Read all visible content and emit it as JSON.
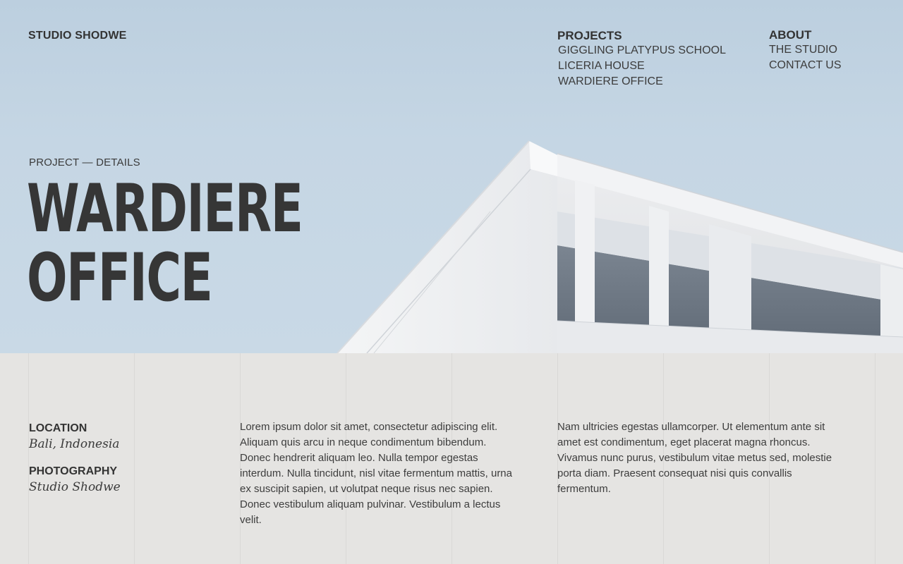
{
  "brand": "STUDIO SHODWE",
  "nav": {
    "projects": {
      "heading": "PROJECTS",
      "items": [
        "GIGGLING PLATYPUS SCHOOL",
        "LICERIA HOUSE",
        "WARDIERE OFFICE"
      ]
    },
    "about": {
      "heading": "ABOUT",
      "items": [
        "THE STUDIO",
        "CONTACT US"
      ]
    }
  },
  "hero": {
    "eyebrow": "PROJECT — DETAILS",
    "title_line1": "WARDIERE",
    "title_line2": "OFFICE"
  },
  "details": {
    "location_label": "LOCATION",
    "location_value": "Bali, Indonesia",
    "photography_label": "PHOTOGRAPHY",
    "photography_value": "Studio Shodwe"
  },
  "paragraphs": [
    "Lorem ipsum dolor sit amet, consectetur adipiscing elit. Aliquam quis arcu in neque condimentum bibendum. Donec hendrerit aliquam leo. Nulla tempor egestas interdum. Nulla tincidunt, nisl vitae fermentum mattis, urna ex suscipit sapien, ut volutpat neque risus nec sapien. Donec vestibulum aliquam pulvinar. Vestibulum a lectus velit.",
    "Nam ultricies egestas ullamcorper. Ut elementum ante sit amet est condimentum, eget placerat magna rhoncus. Vivamus nunc purus, vestibulum vitae metus sed, molestie porta diam. Praesent consequat nisi quis convallis fermentum."
  ],
  "colors": {
    "sky": "#c5d6e4",
    "panel": "#e5e4e2",
    "text": "#363636"
  }
}
